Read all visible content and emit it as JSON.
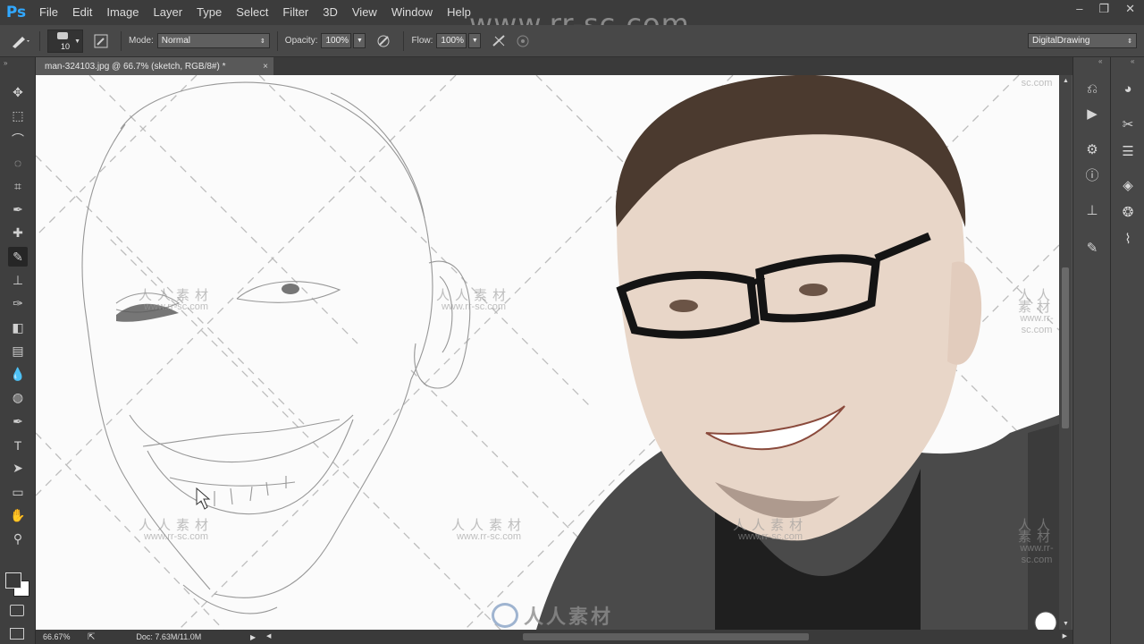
{
  "app": {
    "logo": "Ps"
  },
  "menu": [
    "File",
    "Edit",
    "Image",
    "Layer",
    "Type",
    "Select",
    "Filter",
    "3D",
    "View",
    "Window",
    "Help"
  ],
  "window_controls": [
    "–",
    "❐",
    "✕"
  ],
  "options_bar": {
    "brush_size": "10",
    "mode_label": "Mode:",
    "mode_value": "Normal",
    "opacity_label": "Opacity:",
    "opacity_value": "100%",
    "flow_label": "Flow:",
    "flow_value": "100%",
    "workspace": "DigitalDrawing"
  },
  "document_tab": {
    "title": "man-324103.jpg @ 66.7% (sketch, RGB/8#) *",
    "close": "×"
  },
  "status_bar": {
    "zoom": "66.67%",
    "doc": "Doc: 7.63M/11.0M"
  },
  "watermark": {
    "top": "www.rr-sc.com",
    "cn": "人人素材",
    "url": "www.rr-sc.com",
    "bottom_cn": "人人素材"
  },
  "tools": [
    "move-tool",
    "marquee-tool",
    "lasso-tool",
    "quick-select-tool",
    "crop-tool",
    "eyedropper-tool",
    "healing-tool",
    "brush-tool",
    "stamp-tool",
    "history-brush-tool",
    "eraser-tool",
    "gradient-tool",
    "blur-tool",
    "dodge-tool",
    "pen-tool",
    "type-tool",
    "path-select-tool",
    "shape-tool",
    "hand-tool",
    "zoom-tool"
  ],
  "colors": {
    "foreground": "#3a3a3a",
    "background": "#ffffff",
    "accent": "#31a8ff"
  }
}
